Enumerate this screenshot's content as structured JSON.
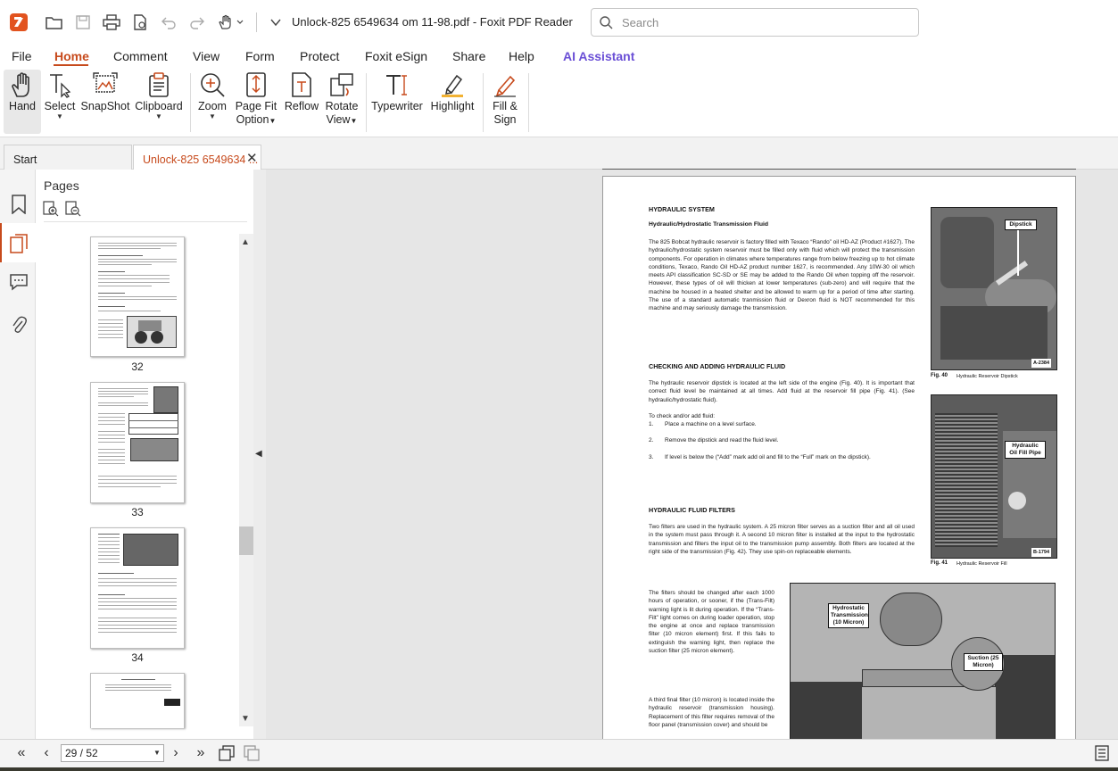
{
  "app": {
    "name": "Foxit PDF Reader",
    "title": "Unlock-825 6549634 om 11-98.pdf - Foxit PDF Reader",
    "accent": "#c74a1c",
    "logo_color": "#e2531f"
  },
  "search": {
    "placeholder": "Search"
  },
  "menu": {
    "items": [
      "File",
      "Home",
      "Comment",
      "View",
      "Form",
      "Protect",
      "Foxit eSign",
      "Share",
      "Help",
      "AI Assistant"
    ],
    "active": "Home",
    "ai_color": "#6a4fd6"
  },
  "ribbon": {
    "hand": "Hand",
    "select": "Select",
    "snapshot": "SnapShot",
    "clipboard": "Clipboard",
    "zoom": "Zoom",
    "pagefit": [
      "Page Fit",
      "Option"
    ],
    "reflow": "Reflow",
    "rotate": [
      "Rotate",
      "View"
    ],
    "typewriter": "Typewriter",
    "highlight": "Highlight",
    "fillsign": [
      "Fill &",
      "Sign"
    ]
  },
  "tabs": {
    "start": "Start",
    "doc": "Unlock-825 6549634 ..."
  },
  "panel": {
    "title": "Pages",
    "thumbs": [
      "32",
      "33",
      "34"
    ]
  },
  "nav": {
    "page_value": "29 / 52"
  },
  "document": {
    "h_hydraulic_system": "HYDRAULIC SYSTEM",
    "h_transmission_fluid": "Hydraulic/Hydrostatic Transmission Fluid",
    "p1": "The 825 Bobcat hydraulic reservoir is factory filled with Texaco “Rando” oil HD-AZ (Product #1627). The hydraulic/hydrostatic system reservoir must be filled only with fluid which will protect the transmission components. For operation in climates where temperatures range from below freezing up to hot climate conditions, Texaco, Rando Oil HD-AZ product number 1627, is recommended. Any 10W-30 oil which meets API classification SC-SD or SE may be added to the Rando Oil when topping off the reservoir. However, these types of oil will thicken at lower temperatures (sub-zero) and will require that the machine be housed in a heated shelter and be allowed to warm up for a period of time after starting. The use of a standard automatic tranmission fluid or Dexron fluid is NOT recommended for this machine and may seriously damage the transmission.",
    "h_checking": "CHECKING AND ADDING HYDRAULIC FLUID",
    "p2": "The hydraulic reservoir dipstick is located at the left side of the engine (Fig. 40). It is important that correct fluid level be maintained at all times. Add fluid at the reservoir fill pipe (Fig. 41). (See hydraulic/hydrostatic fluid).",
    "p3": "To check and/or add fluid:",
    "steps": [
      {
        "n": "1.",
        "t": "Place a machine on a level surface."
      },
      {
        "n": "2.",
        "t": "Remove the dipstick and read the fluid level."
      },
      {
        "n": "3.",
        "t": "If level is below the (“Add” mark add oil and fill to the “Full” mark on the dipstick)."
      }
    ],
    "h_filters": "HYDRAULIC FLUID FILTERS",
    "p4": "Two filters are used in the hydraulic system. A 25 micron filter serves as a suction filter and all oil used in the system must pass through it. A second 10 micron filter is installed at the input to the hydrostatic transmission and filters the input oil to the transmission pump assembly. Both filters are located at the right side of the transmission (Fig. 42). They use spin-on replaceable elements.",
    "p5": "The filters should be changed after each 1000 hours of operation, or sooner, if the (Trans-Filt) warning light is lit during operation. If the “Trans-Filt” light comes on during loader operation, stop the engine at once and replace transmission filter (10 micron element) first. If this fails to extinguish the warning light, then replace the suction filter (25 micron element).",
    "p6": "A third final filter (10 micron) is located inside the hydraulic reservoir (transmission housing). Replacement of this filter requires removal of the floor panel (transmission cover) and should be",
    "fig40": {
      "callout": "Dipstick",
      "code": "A-2384",
      "num": "Fig. 40",
      "caption": "Hydraulic Reservoir Dipstick"
    },
    "fig41": {
      "callout": "Hydraulic Oil Fill Pipe",
      "code": "B-1794",
      "num": "Fig. 41",
      "caption": "Hydraulic Reservoir Fill"
    },
    "fig42": {
      "callout1": "Hydrostatic Transmission (10 Micron)",
      "callout2": "Suction (25 Micron)"
    }
  }
}
